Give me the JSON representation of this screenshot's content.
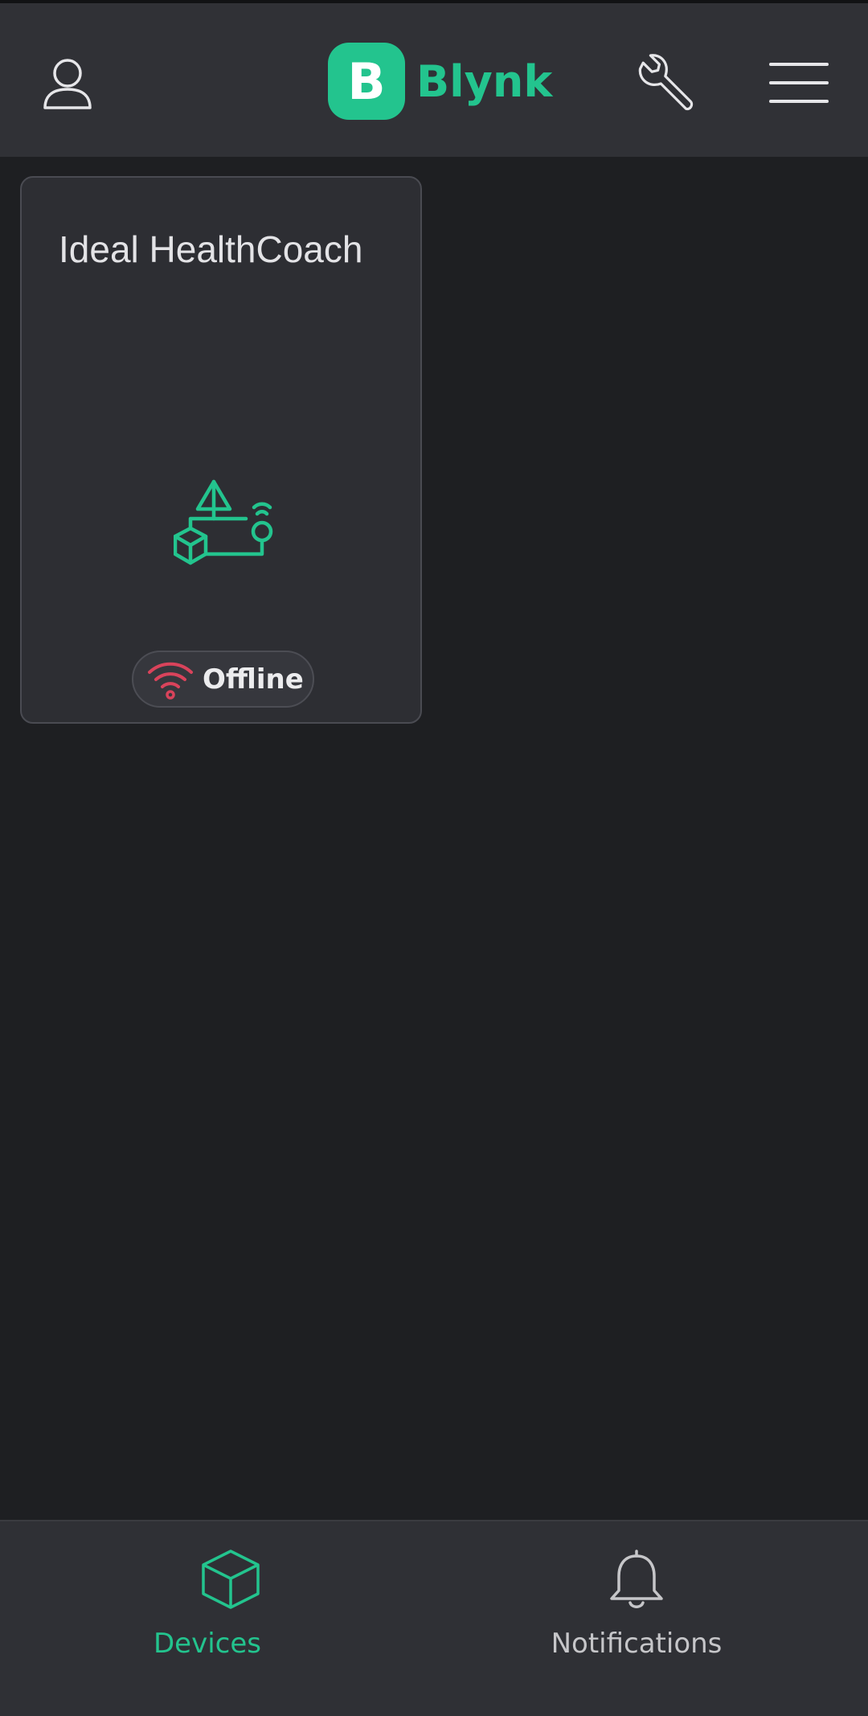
{
  "header": {
    "logo_letter": "B",
    "logo_text": "Blynk",
    "icons": [
      "user-icon",
      "wrench-icon",
      "hamburger-menu-icon"
    ]
  },
  "devices": [
    {
      "name": "Ideal HealthCoach",
      "status": "Offline",
      "icon": "device-template-icon",
      "status_icon": "wifi-off-icon"
    }
  ],
  "bottom_nav": {
    "items": [
      {
        "label": "Devices",
        "icon": "cube-icon",
        "active": true
      },
      {
        "label": "Notifications",
        "icon": "bell-icon",
        "active": false
      }
    ]
  },
  "colors": {
    "accent": "#23c48e",
    "offline": "#d9435b",
    "background": "#1e1f22",
    "header": "#303136",
    "card": "#2d2e33",
    "inactive_text": "#c6c6c9"
  }
}
